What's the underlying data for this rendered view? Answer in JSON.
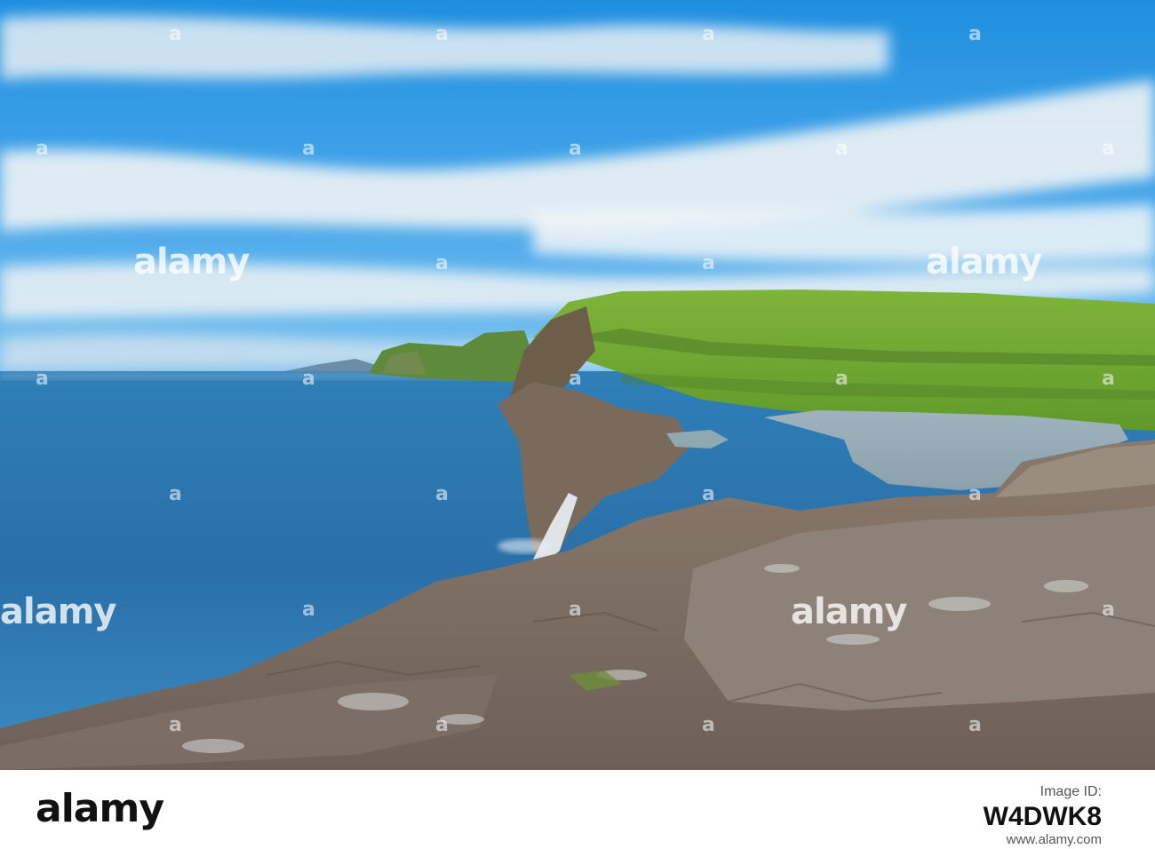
{
  "photo": {
    "description_icon": "landscape-photo-icon"
  },
  "watermark": {
    "text": "alamy",
    "small_mark": "a"
  },
  "footer": {
    "brand": "alamy",
    "label": "Image ID:",
    "image_id": "W4DWK8",
    "url": "www.alamy.com"
  }
}
